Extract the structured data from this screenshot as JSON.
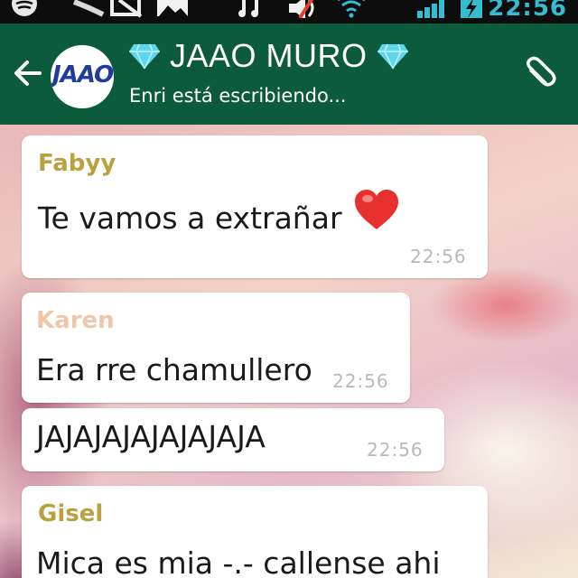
{
  "status_bar": {
    "time": "22:56",
    "left_icons": [
      "spotify-icon",
      "feather-icon",
      "screenshot-icon",
      "image-icon"
    ],
    "right_icons": [
      "music-note-icon",
      "mute-icon",
      "wifi-icon",
      "signal-icon",
      "battery-charging-icon"
    ],
    "accent_color": "#35bcd1"
  },
  "header": {
    "back_icon": "back-arrow-icon",
    "avatar_text": "JAAO",
    "title": "JAAO MURO",
    "title_decoration": "diamond-icon",
    "subtitle": "Enri está escribiendo...",
    "attach_icon": "paperclip-icon",
    "color": "#0c5b3d"
  },
  "messages": [
    {
      "sender": "Fabyy",
      "sender_color": "#b9a23e",
      "text": "Te vamos a extrañar",
      "emoji": "heart-icon",
      "time": "22:56"
    },
    {
      "sender": "Karen",
      "sender_color": "#f0c6a8",
      "text": "Era rre chamullero",
      "time": "22:56"
    },
    {
      "text": "JAJAJAJAJAJAJAJA",
      "time": "22:56"
    },
    {
      "sender": "Gisel",
      "sender_color": "#b9a23e",
      "text": "Mica es mia -.- callense ahi"
    }
  ]
}
